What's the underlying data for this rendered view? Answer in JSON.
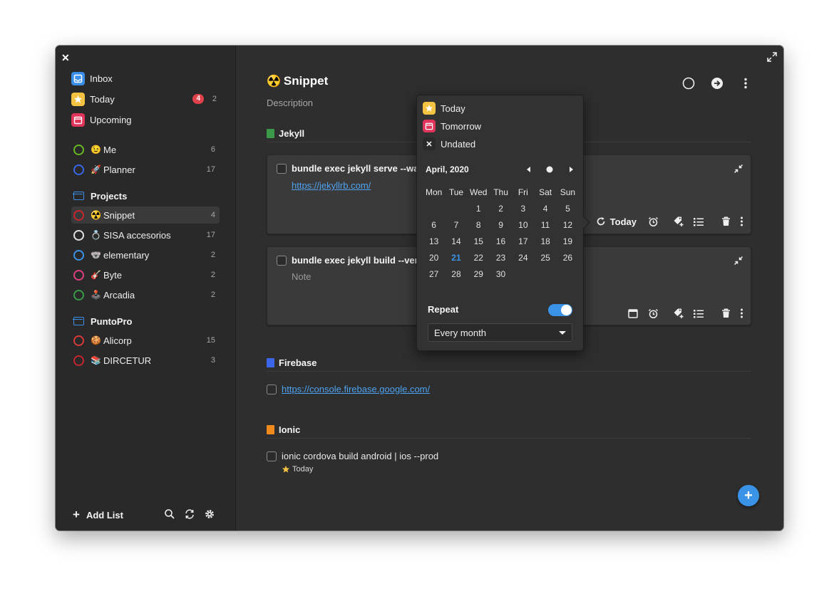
{
  "sidebar": {
    "nav": [
      {
        "label": "Inbox",
        "icon": "inbox-icon",
        "color": "#3b8ee8"
      },
      {
        "label": "Today",
        "icon": "star-icon",
        "color": "#f5c342",
        "badge": "4",
        "count": "2"
      },
      {
        "label": "Upcoming",
        "icon": "calendar-icon",
        "color": "#e0345b"
      }
    ],
    "personal": [
      {
        "emoji": "😉",
        "label": "Me",
        "count": "6",
        "color": "#68b723"
      },
      {
        "emoji": "🚀",
        "label": "Planner",
        "count": "17",
        "color": "#3b66e8"
      }
    ],
    "projects_label": "Projects",
    "projects": [
      {
        "emoji": "☢️",
        "label": "Snippet",
        "count": "4",
        "color": "#c6262e"
      },
      {
        "emoji": "💍",
        "label": "SISA accesorios",
        "count": "17",
        "color": "#e0e0e0"
      },
      {
        "emoji": "🐨",
        "label": "elementary",
        "count": "2",
        "color": "#3b93e8"
      },
      {
        "emoji": "🎸",
        "label": "Byte",
        "count": "2",
        "color": "#de3e80"
      },
      {
        "emoji": "🕹️",
        "label": "Arcadia",
        "count": "2",
        "color": "#3a9a4a"
      }
    ],
    "puntopro_label": "PuntoPro",
    "puntopro": [
      {
        "emoji": "🍪",
        "label": "Alicorp",
        "count": "15",
        "color": "#d63a3a"
      },
      {
        "emoji": "📚",
        "label": "DIRCETUR",
        "count": "3",
        "color": "#c6262e"
      }
    ],
    "add_list_label": "Add List"
  },
  "main": {
    "emoji": "☢️",
    "title": "Snippet",
    "description": "Description",
    "sections": [
      {
        "label": "Jekyll",
        "color": "#3a9a4a"
      },
      {
        "label": "Firebase",
        "color": "#3b66e8"
      },
      {
        "label": "Ionic",
        "color": "#f08a1c"
      }
    ],
    "task1": {
      "title": "bundle exec jekyll serve --wat",
      "link": "https://jekyllrb.com/",
      "date_label": "Today"
    },
    "task2": {
      "title": "bundle exec jekyll build --ver",
      "note": "Note"
    },
    "task3": {
      "link": "https://console.firebase.google.com/"
    },
    "task4": {
      "title": "ionic cordova build android | ios --prod",
      "date_label": "Today"
    }
  },
  "popover": {
    "options": [
      {
        "label": "Today",
        "icon": "star-icon"
      },
      {
        "label": "Tomorrow",
        "icon": "calendar-icon"
      },
      {
        "label": "Undated",
        "icon": "close-icon"
      }
    ],
    "month_label": "April, 2020",
    "weekdays": [
      "Mon",
      "Tue",
      "Wed",
      "Thu",
      "Fri",
      "Sat",
      "Sun"
    ],
    "weeks": [
      [
        "",
        "",
        "1",
        "2",
        "3",
        "4",
        "5"
      ],
      [
        "6",
        "7",
        "8",
        "9",
        "10",
        "11",
        "12"
      ],
      [
        "13",
        "14",
        "15",
        "16",
        "17",
        "18",
        "19"
      ],
      [
        "20",
        "21",
        "22",
        "23",
        "24",
        "25",
        "26"
      ],
      [
        "27",
        "28",
        "29",
        "30",
        "",
        "",
        ""
      ]
    ],
    "selected_day": "21",
    "repeat_label": "Repeat",
    "repeat_enabled": true,
    "repeat_value": "Every month"
  },
  "colors": {
    "accent": "#3b93e8",
    "badge": "#e0424b",
    "bg": "#2e2e2e",
    "sidebar": "#292929"
  }
}
